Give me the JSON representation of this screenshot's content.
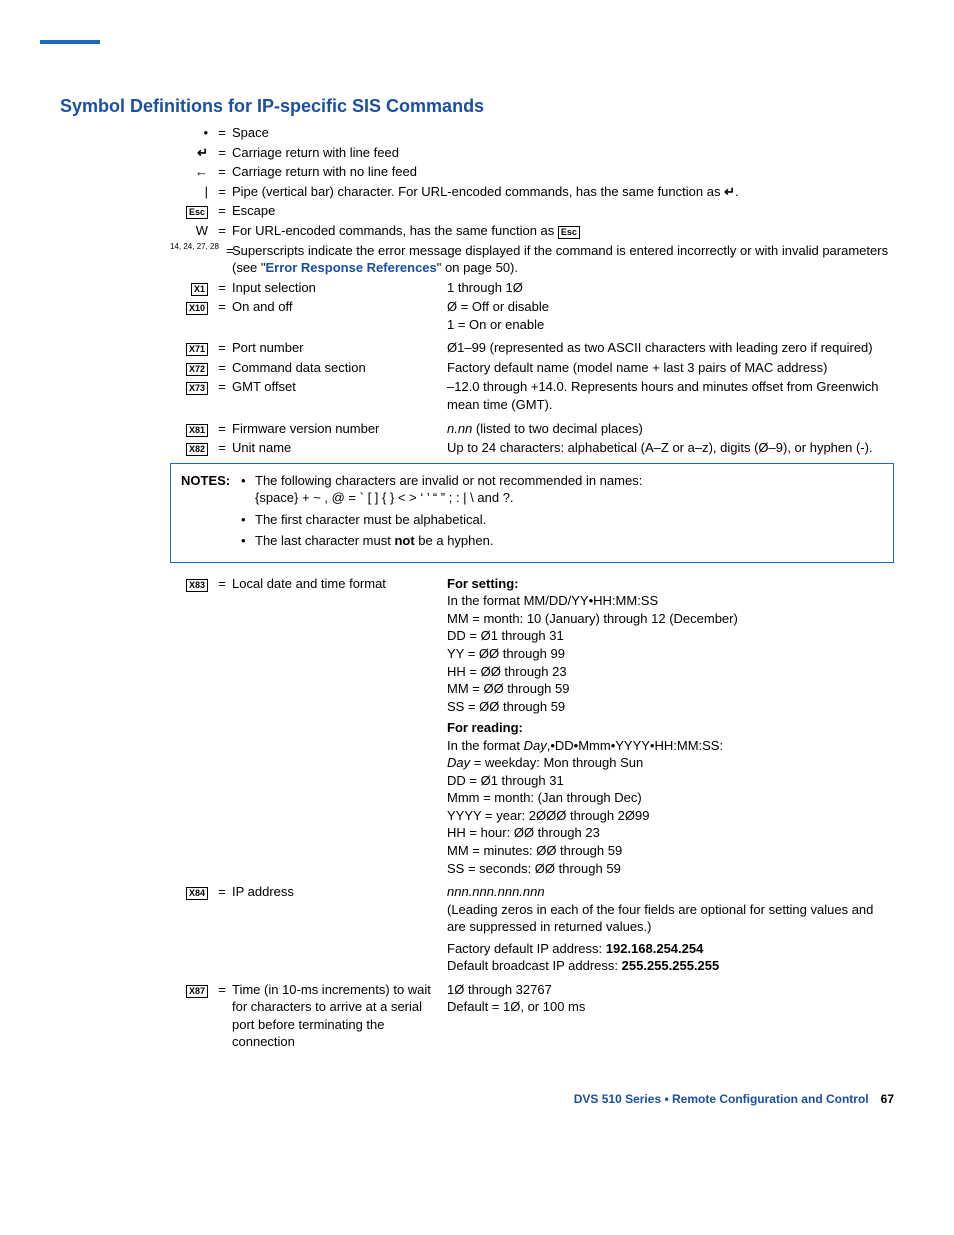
{
  "heading": "Symbol Definitions for IP-specific SIS Commands",
  "rows": {
    "space": {
      "sym": "•",
      "desc": "Space"
    },
    "crlf": {
      "sym": "↵",
      "desc": "Carriage return with line feed"
    },
    "cr": {
      "sym": "←",
      "desc": "Carriage return with no line feed"
    },
    "pipe": {
      "sym": "|",
      "desc1": "Pipe (vertical bar) character. For URL-encoded commands, has the same function as ",
      "desc2": "↵",
      "desc3": "."
    },
    "esc": {
      "sym": "Esc",
      "desc": "Escape"
    },
    "w": {
      "sym": "W",
      "desc1": "For URL-encoded commands, has the same function as ",
      "desc2": "Esc"
    },
    "superscripts": {
      "sym": "14, 24, 27, 28",
      "desc1": "Superscripts indicate the error message displayed if the command is entered incorrectly or with invalid parameters (see \"",
      "link": "Error Response References",
      "desc2": "\" on page 50)."
    },
    "x1": {
      "sym": "X1",
      "left": "Input selection",
      "right": "1 through 1Ø"
    },
    "x10": {
      "sym": "X10",
      "left": "On and off",
      "right1": "Ø = Off or disable",
      "right2": "1 = On or enable"
    },
    "x71": {
      "sym": "X71",
      "left": "Port number",
      "right": "Ø1–99 (represented as two ASCII characters with leading zero if required)"
    },
    "x72": {
      "sym": "X72",
      "left": "Command data section",
      "right": "Factory default name (model name + last 3 pairs of MAC address)"
    },
    "x73": {
      "sym": "X73",
      "left": "GMT offset",
      "right": "–12.0 through +14.0. Represents hours and minutes offset from Greenwich mean time (GMT)."
    },
    "x81": {
      "sym": "X81",
      "left": "Firmware version number",
      "right1": "n.nn",
      "right2": " (listed to two decimal places)"
    },
    "x82": {
      "sym": "X82",
      "left": "Unit name",
      "right": "Up to 24 characters: alphabetical (A–Z  or a–z), digits (Ø–9), or hyphen (-)."
    },
    "x83": {
      "sym": "X83",
      "left": "Local date and time format",
      "setting_label": "For setting:",
      "setting_lines": [
        "In the format MM/DD/YY•HH:MM:SS",
        "MM = month: 10 (January) through 12 (December)",
        "DD = Ø1 through 31",
        "YY = ØØ through 99",
        "HH = ØØ through 23",
        "MM = ØØ through 59",
        "SS = ØØ through 59"
      ],
      "reading_label": "For reading:",
      "reading_prefix": "In the format ",
      "reading_italic": "Day",
      "reading_suffix": ",•DD•Mmm•YYYY•HH:MM:SS:",
      "reading_line2a": "Day",
      "reading_line2b": " = weekday: Mon through Sun",
      "reading_lines": [
        "DD = Ø1 through 31",
        "Mmm = month: (Jan through Dec)",
        "YYYY = year: 2ØØØ through 2Ø99",
        "HH = hour: ØØ through 23",
        "MM = minutes: ØØ through 59",
        "SS = seconds: ØØ through 59"
      ]
    },
    "x84": {
      "sym": "X84",
      "left": "IP address",
      "right1": "nnn.nnn.nnn.nnn",
      "right2": "(Leading zeros in each of the four fields are optional for setting values and are suppressed in returned values.)",
      "right3a": "Factory default IP address: ",
      "right3b": "192.168.254.254",
      "right4a": "Default broadcast IP address: ",
      "right4b": "255.255.255.255"
    },
    "x87": {
      "sym": "X87",
      "left": "Time (in 10-ms increments) to wait for characters to arrive at a serial port before terminating the connection",
      "right1": "1Ø through 32767",
      "right2": "Default = 1Ø, or 100 ms"
    }
  },
  "notes": {
    "label": "NOTES:",
    "n1a": "The following characters are invalid or not recommended in names:",
    "n1b": "{space}  + ~  ,  @ = `  [  ]  {  }  < >  ‘  ’   “  ”  ;  :  |  \\  and  ?.",
    "n2": "The first character must be alphabetical.",
    "n3a": "The last character must ",
    "n3b": "not",
    "n3c": " be a hyphen."
  },
  "footer": {
    "text": "DVS 510 Series • Remote Configuration and Control",
    "page": "67"
  }
}
